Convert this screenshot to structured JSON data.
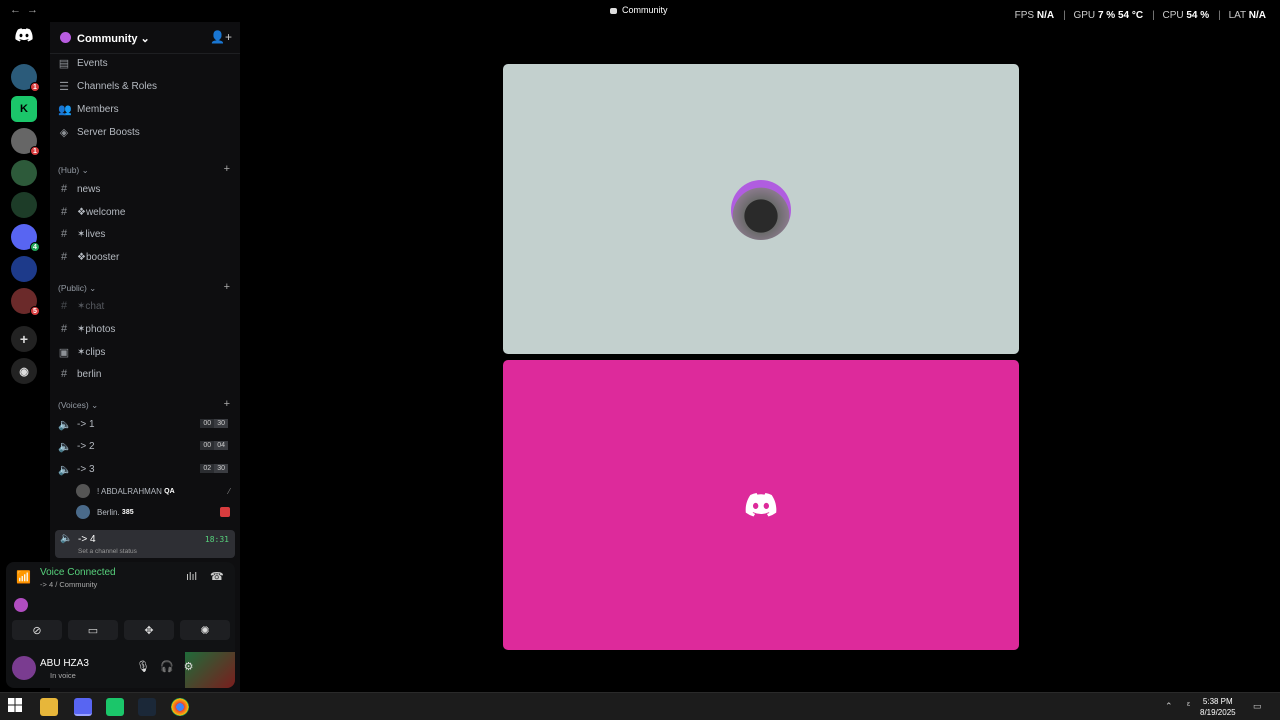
{
  "titlebar": {
    "title": "Community",
    "stats": [
      {
        "label": "FPS",
        "value": "N/A"
      },
      {
        "label": "GPU",
        "value": "7 %  54 °C"
      },
      {
        "label": "CPU",
        "value": "54 %"
      },
      {
        "label": "LAT",
        "value": "N/A"
      }
    ]
  },
  "server": {
    "name": "Community"
  },
  "menu": [
    {
      "label": "Events",
      "icon": "calendar-icon"
    },
    {
      "label": "Channels & Roles",
      "icon": "list-icon"
    },
    {
      "label": "Members",
      "icon": "members-icon"
    },
    {
      "label": "Server Boosts",
      "icon": "boost-icon"
    }
  ],
  "categories": {
    "hub": "(Hub)",
    "public": "(Public)",
    "voices": "(Voices)"
  },
  "hub_channels": [
    "news",
    "❖welcome",
    "✶lives",
    "❖booster"
  ],
  "public_channels": [
    "✶chat",
    "✶photos",
    "✶clips",
    "berlin"
  ],
  "voice_channels": [
    {
      "label": "-> 1",
      "a": "00",
      "b": "30"
    },
    {
      "label": "-> 2",
      "a": "00",
      "b": "04"
    },
    {
      "label": "-> 3",
      "a": "02",
      "b": "30"
    }
  ],
  "voice_users": [
    {
      "name": "! ABDALRAHMAN",
      "tag": "QA"
    },
    {
      "name": "Berlin.",
      "tag": "385"
    }
  ],
  "active_channel": {
    "label": "-> 4",
    "time": "18:31",
    "status": "Set a channel status"
  },
  "voice_panel": {
    "status": "Voice Connected",
    "sub": "-> 4 / Community"
  },
  "user": {
    "name": "ABU HZA3",
    "status": "In voice"
  },
  "clock": {
    "time": "5:38 PM",
    "date": "8/19/2025"
  }
}
